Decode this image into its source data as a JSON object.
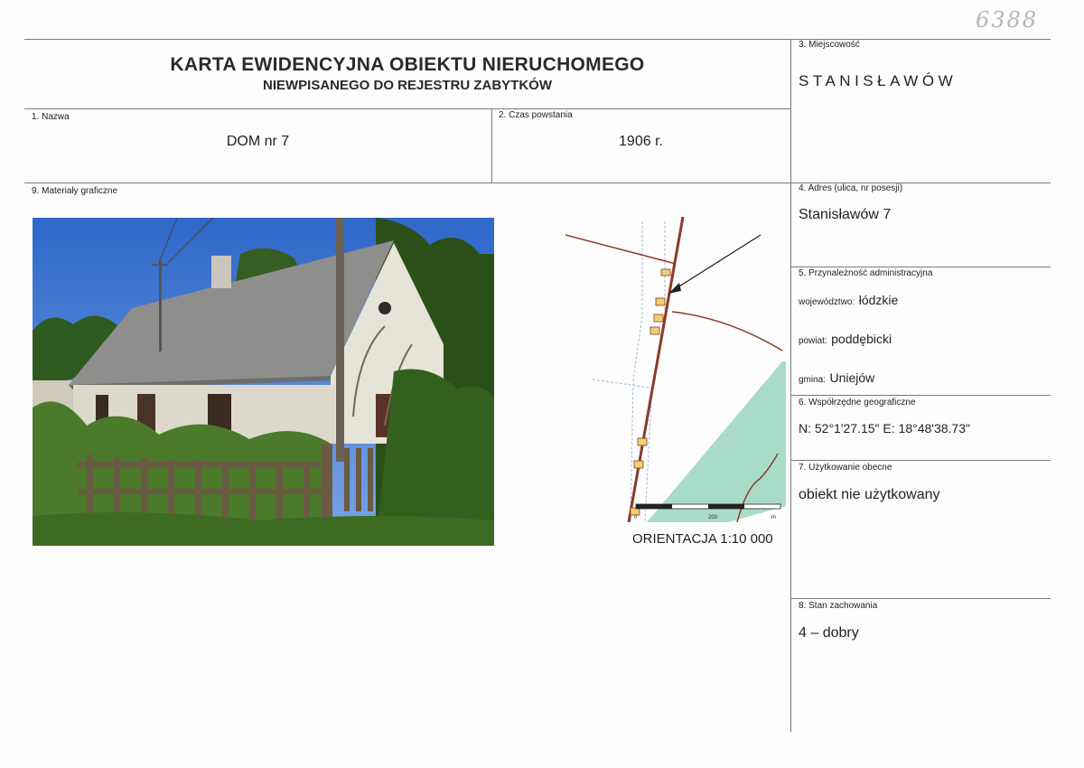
{
  "handwritten_number": "6388",
  "title": {
    "line1": "KARTA EWIDENCYJNA OBIEKTU NIERUCHOMEGO",
    "line2": "NIEWPISANEGO DO REJESTRU ZABYTKÓW"
  },
  "fields": {
    "nazwa": {
      "label": "1. Nazwa",
      "value": "DOM nr 7"
    },
    "czas": {
      "label": "2. Czas powstania",
      "value": "1906 r."
    },
    "miejscowosc": {
      "label": "3. Miejscowość",
      "value": "STANISŁAWÓW"
    },
    "adres": {
      "label": "4. Adres (ulica, nr posesji)",
      "value": "Stanisławów 7"
    },
    "przynaleznosc": {
      "label": "5. Przynależność administracyjna",
      "wojewodztwo_label": "województwo:",
      "wojewodztwo": "łódzkie",
      "powiat_label": "powiat:",
      "powiat": "poddębicki",
      "gmina_label": "gmina:",
      "gmina": "Uniejów"
    },
    "wspolrzedne": {
      "label": "6. Współrzędne geograficzne",
      "value": "N: 52°1'27.15\" E: 18°48'38.73\""
    },
    "uzytkowanie": {
      "label": "7. Użytkowanie obecne",
      "value": "obiekt nie użytkowany"
    },
    "stan": {
      "label": "8. Stan zachowania",
      "value": "4 – dobry"
    },
    "materialy": {
      "label": "9. Materiały graficzne"
    }
  },
  "map": {
    "scale_zero": "0",
    "scale_mid": "200",
    "scale_unit": "m",
    "orientation": "ORIENTACJA 1:10 000"
  },
  "colors": {
    "sky": "#3f78d6",
    "roof": "#8e8f8c",
    "wall": "#e6e4d8",
    "vegetation": "#3f6a22",
    "map_green": "#a9dcc8",
    "map_road": "#8b3a2a"
  }
}
